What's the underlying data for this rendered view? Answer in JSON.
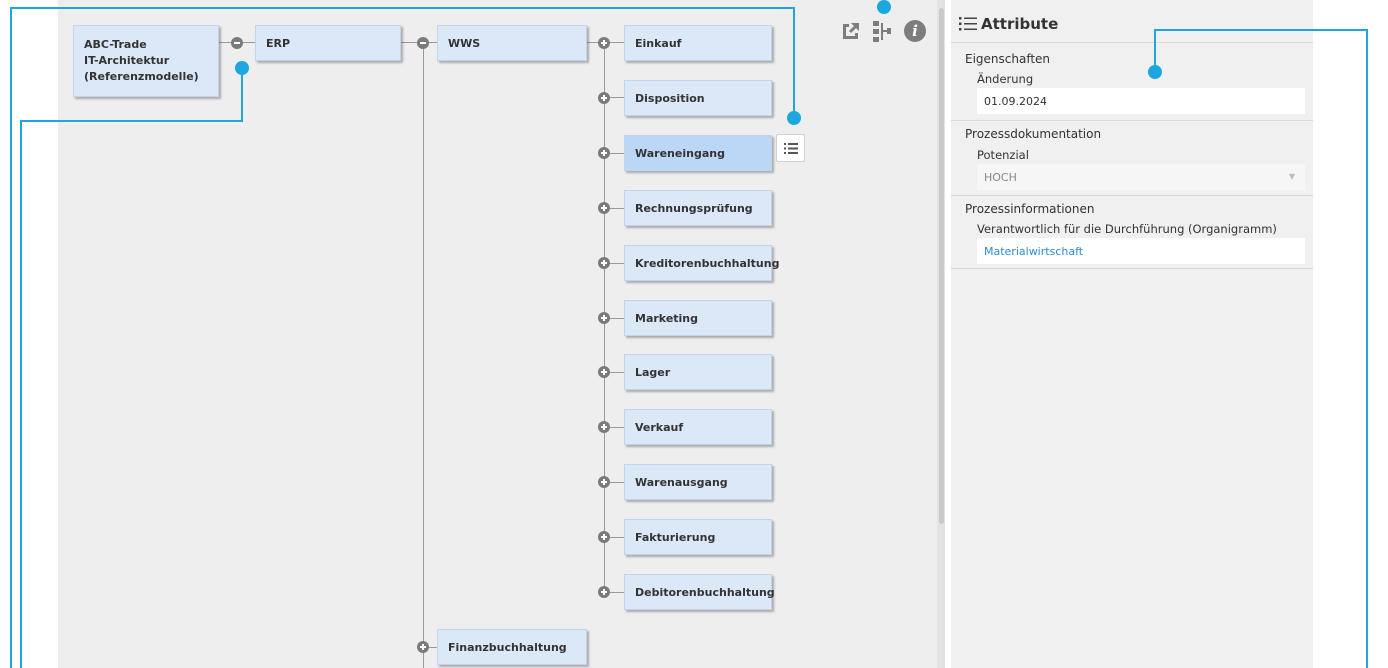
{
  "tree": {
    "root": {
      "lines": [
        "ABC-Trade",
        "IT-Architektur",
        "(Referenzmodelle)"
      ]
    },
    "level1": {
      "label": "ERP"
    },
    "level2": {
      "label": "WWS"
    },
    "children": [
      {
        "label": "Einkauf"
      },
      {
        "label": "Disposition"
      },
      {
        "label": "Wareneingang",
        "selected": true
      },
      {
        "label": "Rechnungsprüfung"
      },
      {
        "label": "Kreditorenbuchhaltung"
      },
      {
        "label": "Marketing"
      },
      {
        "label": "Lager"
      },
      {
        "label": "Verkauf"
      },
      {
        "label": "Warenausgang"
      },
      {
        "label": "Fakturierung"
      },
      {
        "label": "Debitorenbuchhaltung"
      }
    ],
    "sibling": {
      "label": "Finanzbuchhaltung"
    }
  },
  "toolbar": {
    "icons": [
      "external-link-icon",
      "hierarchy-icon",
      "info-icon"
    ],
    "info_glyph": "i"
  },
  "node_action_icon": "list-icon",
  "panel": {
    "title": "Attribute",
    "title_icon": "list-icon",
    "sections": [
      {
        "title": "Eigenschaften",
        "label": "Änderung",
        "value": "01.09.2024"
      },
      {
        "title": "Prozessdokumentation",
        "label": "Potenzial",
        "value": "HOCH",
        "dropdown": true
      },
      {
        "title": "Prozessinformationen",
        "label": "Verantwortlich für die Durchführung (Organigramm)",
        "value": "Materialwirtschaft",
        "link": true
      }
    ]
  },
  "colors": {
    "accent": "#1ca7e0",
    "node_fill": "#dbe8f8",
    "node_selected": "#bcd7f6",
    "link": "#2b8cd8"
  }
}
